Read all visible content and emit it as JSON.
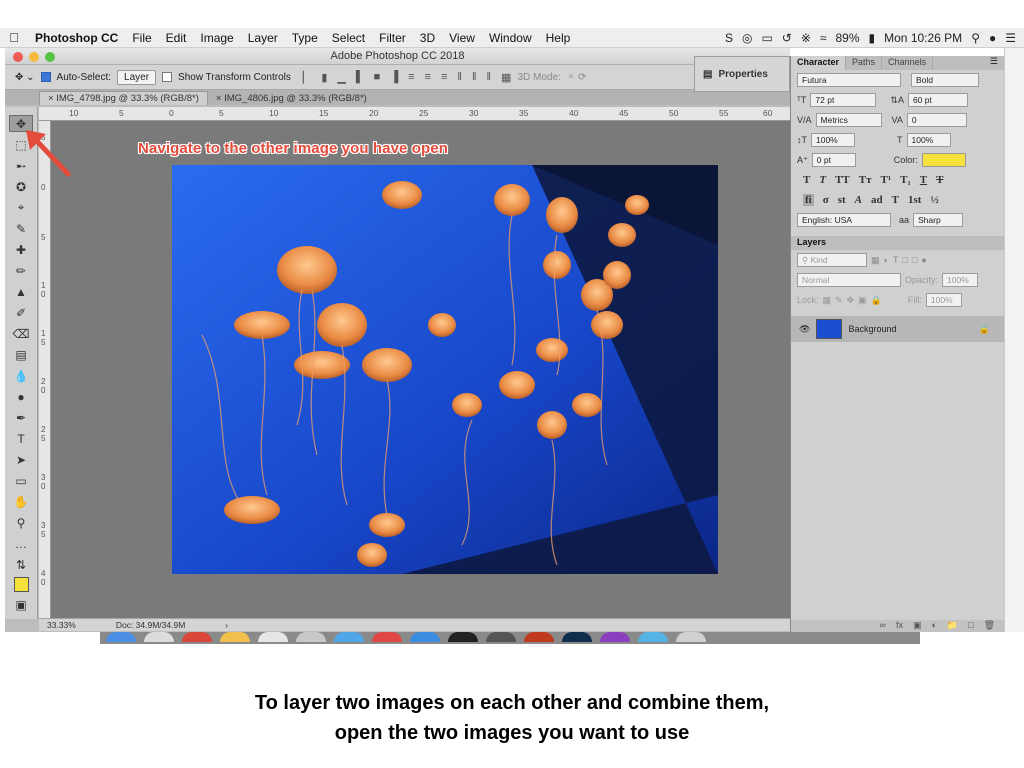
{
  "menubar": {
    "app_name": "Photoshop CC",
    "items": [
      "File",
      "Edit",
      "Image",
      "Layer",
      "Type",
      "Select",
      "Filter",
      "3D",
      "View",
      "Window",
      "Help"
    ],
    "battery": "89%",
    "clock": "Mon 10:26 PM"
  },
  "window": {
    "title": "Adobe Photoshop CC 2018"
  },
  "options_bar": {
    "auto_select_label": "Auto-Select:",
    "auto_select_value": "Layer",
    "show_transform_label": "Show Transform Controls",
    "mode_3d_label": "3D Mode:"
  },
  "properties_panel": {
    "label": "Properties"
  },
  "document_tabs": [
    {
      "label": "IMG_4798.jpg @ 33.3% (RGB/8*)",
      "active": true
    },
    {
      "label": "IMG_4806.jpg @ 33.3% (RGB/8*)",
      "active": false
    }
  ],
  "ruler": {
    "h_ticks": [
      "10",
      "5",
      "0",
      "5",
      "10",
      "15",
      "20",
      "25",
      "30",
      "35",
      "40",
      "45",
      "50",
      "55",
      "60"
    ],
    "v_ticks": [
      "5",
      "0",
      "5",
      "1\n0",
      "1\n5",
      "2\n0",
      "2\n5",
      "3\n0",
      "3\n5",
      "4\n0"
    ]
  },
  "annotation": {
    "text": "Navigate to the other image you have open",
    "color": "#e34b3b"
  },
  "status_bar": {
    "zoom": "33.33%",
    "doc_size": "Doc: 34.9M/34.9M"
  },
  "character_panel": {
    "tabs": [
      "Character",
      "Paths",
      "Channels"
    ],
    "font_family": "Futura",
    "font_style": "Bold",
    "font_size": "72 pt",
    "leading": "60 pt",
    "kerning": "Metrics",
    "tracking": "0",
    "vertical_scale": "100%",
    "horizontal_scale": "100%",
    "baseline_shift": "0 pt",
    "color_label": "Color:",
    "color_value": "#f6e03c",
    "language": "English: USA",
    "antialias_label": "aa",
    "antialias": "Sharp"
  },
  "layers_panel": {
    "title": "Layers",
    "kind_label": "Kind",
    "blend_mode": "Normal",
    "opacity_label": "Opacity:",
    "opacity_value": "100%",
    "lock_label": "Lock:",
    "fill_label": "Fill:",
    "fill_value": "100%",
    "layers": [
      {
        "name": "Background",
        "visible": true,
        "locked": true
      }
    ]
  },
  "caption": {
    "line1": "To layer two images on each other and combine them,",
    "line2": "open the two images you want to use"
  }
}
